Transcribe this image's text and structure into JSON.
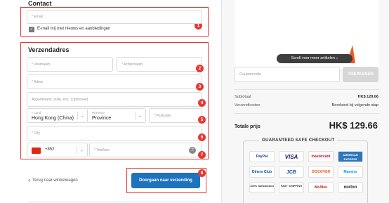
{
  "contact": {
    "heading": "Contact",
    "email_placeholder": "* Email",
    "newsletter_label": "E-mail mij met nieuws en aanbiedingen",
    "newsletter_checked": true
  },
  "shipping": {
    "heading": "Verzendadres",
    "firstname_placeholder": "* Voornaam",
    "lastname_placeholder": "* Achternaam",
    "address_placeholder": "* Adres",
    "apt_placeholder": "Appartement, suite, enz. (Optioneel)",
    "country_label": "* Land",
    "country_value": "Hong Kong (China)",
    "province_label": "Province",
    "province_value": "Province",
    "postcode_placeholder": "* Postcode",
    "city_placeholder": "* City",
    "phone_code": "+852",
    "phone_placeholder": "* Telefoon",
    "help_glyph": "?"
  },
  "badges": [
    "1",
    "2",
    "3",
    "4",
    "5",
    "6",
    "7",
    "8"
  ],
  "actions": {
    "back_label": "Terug naar winkelwagen",
    "back_glyph": "‹",
    "continue_label": "Doorgaan naar verzending"
  },
  "summary": {
    "scroll_hint": "Scroll voor meer artikelen",
    "scroll_glyph": "↓",
    "coupon_placeholder": "Couponcode",
    "apply_label": "TOEPASSEN",
    "subtotal_label": "Subtotaal",
    "subtotal_value": "HK$ 129.66",
    "shipping_label": "Verzendkosten",
    "shipping_value": "Berekend bij volgende stap",
    "total_label": "Totale prijs",
    "total_value": "HK$ 129.66"
  },
  "trust": {
    "title": "GUARANTEED SAFE CHECKOUT",
    "payments": [
      "PayPal",
      "VISA",
      "mastercard",
      "AMERICAN EXPRESS",
      "Diners Club",
      "JCB",
      "DISCOVER",
      "Maestro"
    ],
    "seals": [
      "100% Satisfaction",
      "FAST SHIPPING",
      "McAfee",
      "norton"
    ]
  },
  "colors": {
    "accent_red": "#e53935",
    "primary_blue": "#1e73be",
    "banner_orange": "#f05a1f"
  }
}
